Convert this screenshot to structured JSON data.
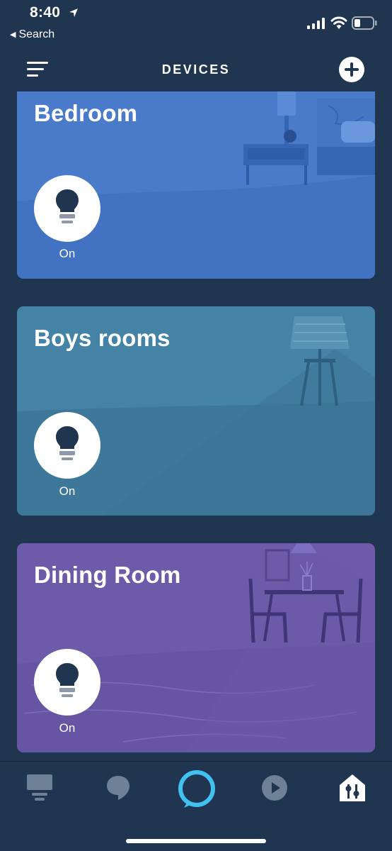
{
  "status_bar": {
    "time": "8:40",
    "back_label": "Search",
    "icons": [
      "location-arrow-icon",
      "cellular-signal-icon",
      "wifi-icon",
      "battery-icon"
    ]
  },
  "header": {
    "title": "DEVICES",
    "menu_icon": "hamburger-menu-icon",
    "add_icon": "plus-icon"
  },
  "device_groups": [
    {
      "name": "Bedroom",
      "device_icon": "light-bulb-icon",
      "state": "On",
      "color": "#4a7bcb"
    },
    {
      "name": "Boys rooms",
      "device_icon": "light-bulb-icon",
      "state": "On",
      "color": "#4482a6"
    },
    {
      "name": "Dining Room",
      "device_icon": "light-bulb-icon",
      "state": "On",
      "color": "#6b5ba8"
    }
  ],
  "tab_bar": {
    "tabs": [
      {
        "icon": "home-icon",
        "active": false
      },
      {
        "icon": "chat-bubble-icon",
        "active": false
      },
      {
        "icon": "alexa-ring-icon",
        "active": false
      },
      {
        "icon": "play-icon",
        "active": false
      },
      {
        "icon": "devices-icon",
        "active": true
      }
    ]
  },
  "colors": {
    "background": "#1f3550",
    "alexa_accent": "#42c0f0",
    "inactive_tab": "#6f8196"
  }
}
